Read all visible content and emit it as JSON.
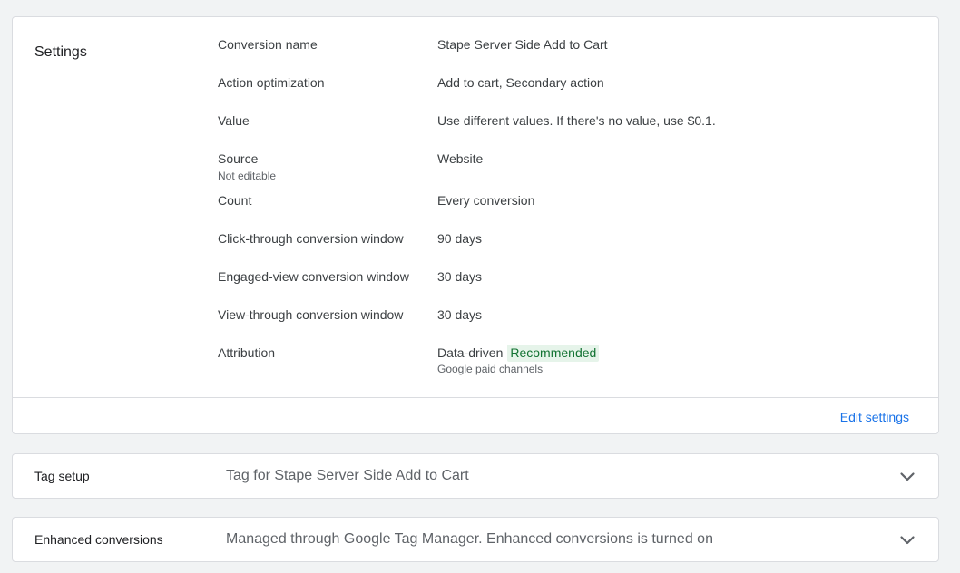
{
  "settings": {
    "title": "Settings",
    "rows": [
      {
        "label": "Conversion name",
        "value": "Stape Server Side Add to Cart"
      },
      {
        "label": "Action optimization",
        "value": "Add to cart, Secondary action"
      },
      {
        "label": "Value",
        "value": "Use different values. If there's no value, use $0.1."
      },
      {
        "label": "Source",
        "label_sub": "Not editable",
        "value": "Website"
      },
      {
        "label": "Count",
        "value": "Every conversion"
      },
      {
        "label": "Click-through conversion window",
        "value": "90 days"
      },
      {
        "label": "Engaged-view conversion window",
        "value": "30 days"
      },
      {
        "label": "View-through conversion window",
        "value": "30 days"
      },
      {
        "label": "Attribution",
        "value": "Data-driven",
        "badge": "Recommended",
        "value_sub": "Google paid channels"
      }
    ],
    "edit_label": "Edit settings"
  },
  "tag_setup": {
    "title": "Tag setup",
    "summary": "Tag for Stape Server Side Add to Cart",
    "icon": "chevron-down-icon"
  },
  "enhanced_conversions": {
    "title": "Enhanced conversions",
    "summary": "Managed through Google Tag Manager. Enhanced conversions is turned on",
    "icon": "chevron-down-icon"
  },
  "colors": {
    "accent": "#1a73e8",
    "badge_bg": "#e6f4ea",
    "badge_text": "#137333"
  }
}
